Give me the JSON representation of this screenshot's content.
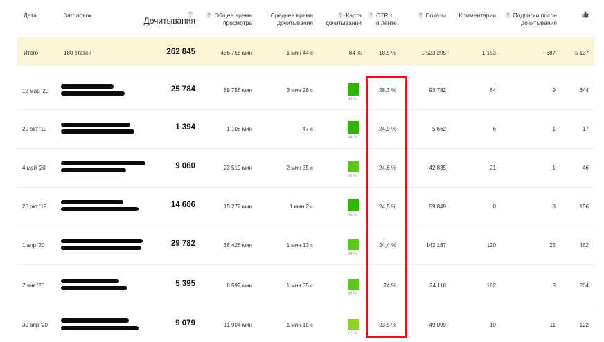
{
  "header": {
    "date": "Дата",
    "title": "Заголовок",
    "reads": "Дочитывания",
    "total_time": [
      "Общее время",
      "просмотра"
    ],
    "avg_time": [
      "Среднее время",
      "дочитывания"
    ],
    "read_map": [
      "Карта",
      "дочитываний"
    ],
    "ctr": [
      "CTR",
      "в ленте"
    ],
    "impressions": "Показы",
    "comments": "Комментарии",
    "subs": [
      "Подписки после",
      "дочитывания"
    ],
    "question_mark": "?",
    "sort_arrow": "↓"
  },
  "total": {
    "label": "Итого",
    "articles": "180 статей",
    "reads": "262 845",
    "total_time": "456 756 мин",
    "avg_time": "1 мин 44 с",
    "read_map": "84 %",
    "ctr": "18,5 %",
    "impressions": "1 523 205",
    "comments": "1 153",
    "subs": "687",
    "likes": "5 137"
  },
  "rows": [
    {
      "date": "12 мар '20",
      "reads": "25 784",
      "total_time": "89 756 мин",
      "avg_time": "3 мин 28 с",
      "map_pct": "93 %",
      "map_level": 0.93,
      "ctr": "28,3 %",
      "impressions": "93 782",
      "comments": "64",
      "subs": "9",
      "likes": "344"
    },
    {
      "date": "20 окт '19",
      "reads": "1 394",
      "total_time": "1 106 мин",
      "avg_time": "47 с",
      "map_pct": "94 %",
      "map_level": 0.94,
      "ctr": "24,9 %",
      "impressions": "5 662",
      "comments": "6",
      "subs": "1",
      "likes": "17"
    },
    {
      "date": "4 май '20",
      "reads": "9 060",
      "total_time": "23 519 мин",
      "avg_time": "2 мин 35 с",
      "map_pct": "85 %",
      "map_level": 0.85,
      "ctr": "24,6 %",
      "impressions": "42 835",
      "comments": "21",
      "subs": "1",
      "likes": "46"
    },
    {
      "date": "26 окт '19",
      "reads": "14 666",
      "total_time": "15 272 мин",
      "avg_time": "1 мин 2 с",
      "map_pct": "95 %",
      "map_level": 0.95,
      "ctr": "24,5 %",
      "impressions": "59 849",
      "comments": "0",
      "subs": "8",
      "likes": "156"
    },
    {
      "date": "1 апр '20",
      "reads": "29 782",
      "total_time": "36 426 мин",
      "avg_time": "1 мин 13 с",
      "map_pct": "84 %",
      "map_level": 0.84,
      "ctr": "24,4 %",
      "impressions": "142 187",
      "comments": "120",
      "subs": "25",
      "likes": "462"
    },
    {
      "date": "7 янв '20",
      "reads": "5 395",
      "total_time": "8 592 мин",
      "avg_time": "1 мин 35 с",
      "map_pct": "85 %",
      "map_level": 0.85,
      "ctr": "24 %",
      "impressions": "24 118",
      "comments": "162",
      "subs": "8",
      "likes": "204"
    },
    {
      "date": "30 апр '20",
      "reads": "9 079",
      "total_time": "11 904 мин",
      "avg_time": "1 мин 18 с",
      "map_pct": "77 %",
      "map_level": 0.77,
      "ctr": "23,5 %",
      "impressions": "49 099",
      "comments": "10",
      "subs": "11",
      "likes": "122"
    }
  ],
  "colors": {
    "highlight": "#e3141c",
    "total_bg": "#fbf5d6",
    "bar_high": "#2fb400",
    "bar_mid": "#5ec51a",
    "bar_low": "#8fd32a"
  },
  "icons": {
    "likes": "thumbs-up-icon"
  }
}
